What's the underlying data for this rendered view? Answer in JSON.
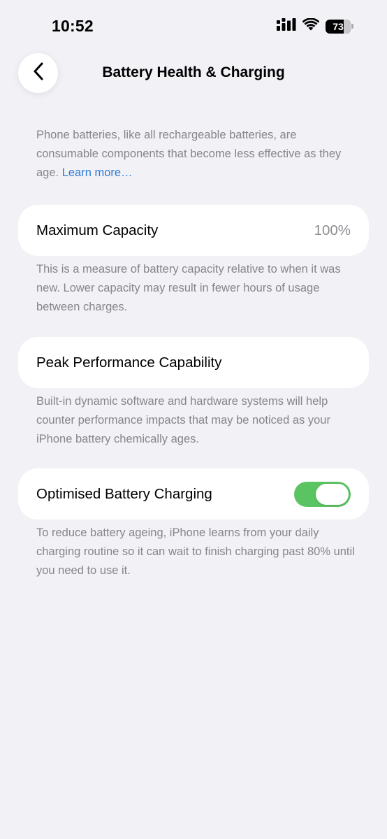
{
  "status_bar": {
    "time": "10:52",
    "battery_percent": "73",
    "battery_level": 0.73
  },
  "nav": {
    "title": "Battery Health & Charging",
    "back_icon": "chevron-left-icon"
  },
  "intro": {
    "text": "Phone batteries, like all rechargeable batteries, are consumable components that become less effective as they age. ",
    "link_label": "Learn more…"
  },
  "max_capacity": {
    "label": "Maximum Capacity",
    "value": "100%",
    "note": "This is a measure of battery capacity relative to when it was new. Lower capacity may result in fewer hours of usage between charges."
  },
  "peak_performance": {
    "label": "Peak Performance Capability",
    "note": "Built-in dynamic software and hardware systems will help counter performance impacts that may be noticed as your iPhone battery chemically ages."
  },
  "optimised_charging": {
    "label": "Optimised Battery Charging",
    "enabled": true,
    "note": "To reduce battery ageing, iPhone learns from your daily charging routine so it can wait to finish charging past 80% until you need to use it."
  },
  "colors": {
    "background": "#f2f1f6",
    "link": "#2f7bd5",
    "toggle_on": "#5bc462",
    "secondary_text": "#86858b"
  }
}
